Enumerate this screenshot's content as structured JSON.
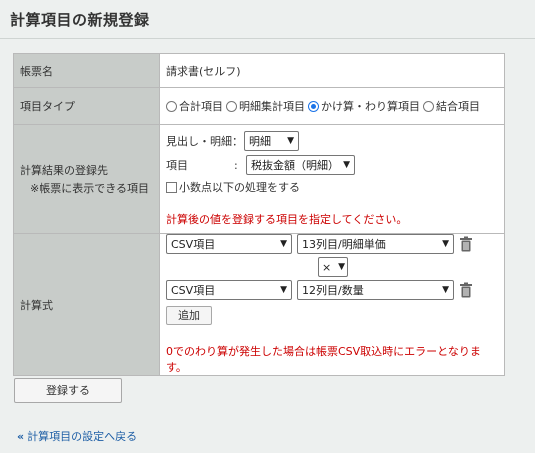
{
  "page": {
    "title": "計算項目の新規登録"
  },
  "form": {
    "name": {
      "label": "帳票名",
      "value": "請求書(セルフ)"
    },
    "type": {
      "label": "項目タイプ",
      "options": [
        "合計項目",
        "明細集計項目",
        "かけ算・わり算項目",
        "結合項目"
      ],
      "selected": "かけ算・わり算項目"
    },
    "dest": {
      "label": "計算結果の登録先",
      "note": "※帳票に表示できる項目",
      "heading_label": "見出し・明細：",
      "heading_value": "明細",
      "item_label": "項目",
      "item_colon": ":",
      "item_value": "税抜金額（明細）",
      "checkbox_label": "小数点以下の処理をする",
      "hint": "計算後の値を登録する項目を指定してください。"
    },
    "formula": {
      "label": "計算式",
      "row1_source": "CSV項目",
      "row1_field": "13列目/明細単価",
      "operator": "×",
      "row2_source": "CSV項目",
      "row2_field": "12列目/数量",
      "add_label": "追加",
      "warning": "0でのわり算が発生した場合は帳票CSV取込時にエラーとなります。"
    }
  },
  "actions": {
    "submit_label": "登録する",
    "back_arrow": "«",
    "back_label": "計算項目の設定へ戻る"
  },
  "colors": {
    "label_bg": "#c8ccc9",
    "page_bg": "#edf0ef",
    "warning": "#cc0000",
    "link": "#1f5fa6",
    "radio_selected": "#1a73e8"
  },
  "icons": {
    "trash": "trash-icon",
    "dropdown": "chevron-down-icon",
    "back": "double-chevron-left-icon"
  }
}
